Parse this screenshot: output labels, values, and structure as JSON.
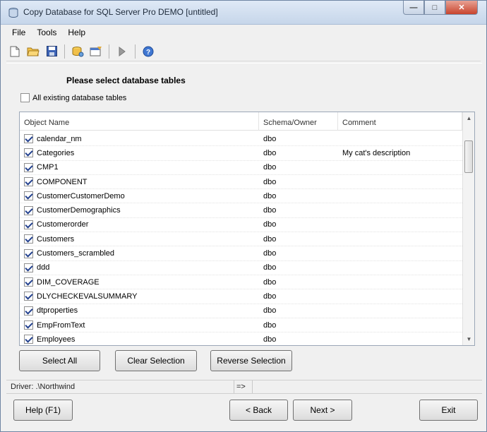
{
  "window": {
    "title": "Copy Database for SQL Server Pro DEMO [untitled]",
    "minimize_icon": "minimize-icon",
    "maximize_icon": "maximize-icon",
    "close_icon": "close-icon"
  },
  "menu": {
    "items": [
      {
        "label": "File"
      },
      {
        "label": "Tools"
      },
      {
        "label": "Help"
      }
    ]
  },
  "toolbar": {
    "icons": [
      "new-file-icon",
      "open-folder-icon",
      "save-icon",
      "connection-icon",
      "properties-icon",
      "run-icon",
      "help-icon"
    ]
  },
  "page": {
    "heading": "Please select database tables",
    "all_tables_label": "All existing database tables",
    "all_tables_checked": false
  },
  "grid": {
    "columns": {
      "name": "Object Name",
      "schema": "Schema/Owner",
      "comment": "Comment"
    },
    "rows": [
      {
        "name": "calendar_nm",
        "schema": "dbo",
        "comment": "",
        "checked": true
      },
      {
        "name": "Categories",
        "schema": "dbo",
        "comment": "My cat's description",
        "checked": true
      },
      {
        "name": "CMP1",
        "schema": "dbo",
        "comment": "",
        "checked": true
      },
      {
        "name": "COMPONENT",
        "schema": "dbo",
        "comment": "",
        "checked": true
      },
      {
        "name": "CustomerCustomerDemo",
        "schema": "dbo",
        "comment": "",
        "checked": true
      },
      {
        "name": "CustomerDemographics",
        "schema": "dbo",
        "comment": "",
        "checked": true
      },
      {
        "name": "Customerorder",
        "schema": "dbo",
        "comment": "",
        "checked": true
      },
      {
        "name": "Customers",
        "schema": "dbo",
        "comment": "",
        "checked": true
      },
      {
        "name": "Customers_scrambled",
        "schema": "dbo",
        "comment": "",
        "checked": true
      },
      {
        "name": "ddd",
        "schema": "dbo",
        "comment": "",
        "checked": true
      },
      {
        "name": "DIM_COVERAGE",
        "schema": "dbo",
        "comment": "",
        "checked": true
      },
      {
        "name": "DLYCHECKEVALSUMMARY",
        "schema": "dbo",
        "comment": "",
        "checked": true
      },
      {
        "name": "dtproperties",
        "schema": "dbo",
        "comment": "",
        "checked": true
      },
      {
        "name": "EmpFromText",
        "schema": "dbo",
        "comment": "",
        "checked": true
      },
      {
        "name": "Employees",
        "schema": "dbo",
        "comment": "",
        "checked": true
      }
    ]
  },
  "selection_buttons": {
    "select_all": "Select All",
    "clear": "Clear Selection",
    "reverse": "Reverse Selection"
  },
  "status": {
    "driver": "Driver:  .\\Northwind",
    "arrow": "=>"
  },
  "footer": {
    "help": "Help (F1)",
    "back": "< Back",
    "next": "Next >",
    "exit": "Exit"
  }
}
